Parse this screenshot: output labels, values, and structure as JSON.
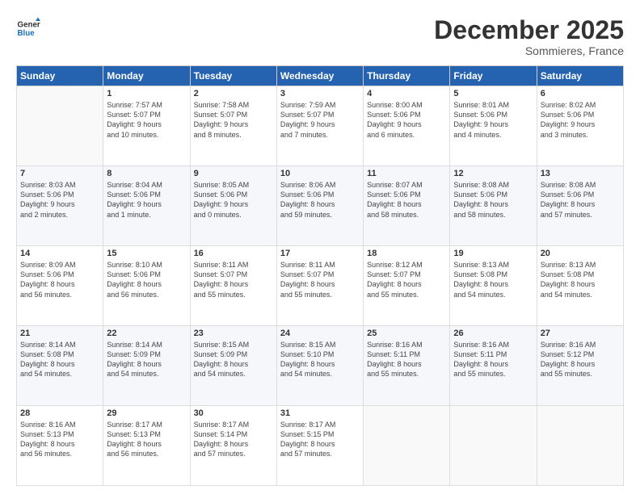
{
  "logo": {
    "line1": "General",
    "line2": "Blue"
  },
  "title": "December 2025",
  "subtitle": "Sommieres, France",
  "days_header": [
    "Sunday",
    "Monday",
    "Tuesday",
    "Wednesday",
    "Thursday",
    "Friday",
    "Saturday"
  ],
  "weeks": [
    [
      {
        "day": "",
        "info": ""
      },
      {
        "day": "1",
        "info": "Sunrise: 7:57 AM\nSunset: 5:07 PM\nDaylight: 9 hours\nand 10 minutes."
      },
      {
        "day": "2",
        "info": "Sunrise: 7:58 AM\nSunset: 5:07 PM\nDaylight: 9 hours\nand 8 minutes."
      },
      {
        "day": "3",
        "info": "Sunrise: 7:59 AM\nSunset: 5:07 PM\nDaylight: 9 hours\nand 7 minutes."
      },
      {
        "day": "4",
        "info": "Sunrise: 8:00 AM\nSunset: 5:06 PM\nDaylight: 9 hours\nand 6 minutes."
      },
      {
        "day": "5",
        "info": "Sunrise: 8:01 AM\nSunset: 5:06 PM\nDaylight: 9 hours\nand 4 minutes."
      },
      {
        "day": "6",
        "info": "Sunrise: 8:02 AM\nSunset: 5:06 PM\nDaylight: 9 hours\nand 3 minutes."
      }
    ],
    [
      {
        "day": "7",
        "info": "Sunrise: 8:03 AM\nSunset: 5:06 PM\nDaylight: 9 hours\nand 2 minutes."
      },
      {
        "day": "8",
        "info": "Sunrise: 8:04 AM\nSunset: 5:06 PM\nDaylight: 9 hours\nand 1 minute."
      },
      {
        "day": "9",
        "info": "Sunrise: 8:05 AM\nSunset: 5:06 PM\nDaylight: 9 hours\nand 0 minutes."
      },
      {
        "day": "10",
        "info": "Sunrise: 8:06 AM\nSunset: 5:06 PM\nDaylight: 8 hours\nand 59 minutes."
      },
      {
        "day": "11",
        "info": "Sunrise: 8:07 AM\nSunset: 5:06 PM\nDaylight: 8 hours\nand 58 minutes."
      },
      {
        "day": "12",
        "info": "Sunrise: 8:08 AM\nSunset: 5:06 PM\nDaylight: 8 hours\nand 58 minutes."
      },
      {
        "day": "13",
        "info": "Sunrise: 8:08 AM\nSunset: 5:06 PM\nDaylight: 8 hours\nand 57 minutes."
      }
    ],
    [
      {
        "day": "14",
        "info": "Sunrise: 8:09 AM\nSunset: 5:06 PM\nDaylight: 8 hours\nand 56 minutes."
      },
      {
        "day": "15",
        "info": "Sunrise: 8:10 AM\nSunset: 5:06 PM\nDaylight: 8 hours\nand 56 minutes."
      },
      {
        "day": "16",
        "info": "Sunrise: 8:11 AM\nSunset: 5:07 PM\nDaylight: 8 hours\nand 55 minutes."
      },
      {
        "day": "17",
        "info": "Sunrise: 8:11 AM\nSunset: 5:07 PM\nDaylight: 8 hours\nand 55 minutes."
      },
      {
        "day": "18",
        "info": "Sunrise: 8:12 AM\nSunset: 5:07 PM\nDaylight: 8 hours\nand 55 minutes."
      },
      {
        "day": "19",
        "info": "Sunrise: 8:13 AM\nSunset: 5:08 PM\nDaylight: 8 hours\nand 54 minutes."
      },
      {
        "day": "20",
        "info": "Sunrise: 8:13 AM\nSunset: 5:08 PM\nDaylight: 8 hours\nand 54 minutes."
      }
    ],
    [
      {
        "day": "21",
        "info": "Sunrise: 8:14 AM\nSunset: 5:08 PM\nDaylight: 8 hours\nand 54 minutes."
      },
      {
        "day": "22",
        "info": "Sunrise: 8:14 AM\nSunset: 5:09 PM\nDaylight: 8 hours\nand 54 minutes."
      },
      {
        "day": "23",
        "info": "Sunrise: 8:15 AM\nSunset: 5:09 PM\nDaylight: 8 hours\nand 54 minutes."
      },
      {
        "day": "24",
        "info": "Sunrise: 8:15 AM\nSunset: 5:10 PM\nDaylight: 8 hours\nand 54 minutes."
      },
      {
        "day": "25",
        "info": "Sunrise: 8:16 AM\nSunset: 5:11 PM\nDaylight: 8 hours\nand 55 minutes."
      },
      {
        "day": "26",
        "info": "Sunrise: 8:16 AM\nSunset: 5:11 PM\nDaylight: 8 hours\nand 55 minutes."
      },
      {
        "day": "27",
        "info": "Sunrise: 8:16 AM\nSunset: 5:12 PM\nDaylight: 8 hours\nand 55 minutes."
      }
    ],
    [
      {
        "day": "28",
        "info": "Sunrise: 8:16 AM\nSunset: 5:13 PM\nDaylight: 8 hours\nand 56 minutes."
      },
      {
        "day": "29",
        "info": "Sunrise: 8:17 AM\nSunset: 5:13 PM\nDaylight: 8 hours\nand 56 minutes."
      },
      {
        "day": "30",
        "info": "Sunrise: 8:17 AM\nSunset: 5:14 PM\nDaylight: 8 hours\nand 57 minutes."
      },
      {
        "day": "31",
        "info": "Sunrise: 8:17 AM\nSunset: 5:15 PM\nDaylight: 8 hours\nand 57 minutes."
      },
      {
        "day": "",
        "info": ""
      },
      {
        "day": "",
        "info": ""
      },
      {
        "day": "",
        "info": ""
      }
    ]
  ]
}
